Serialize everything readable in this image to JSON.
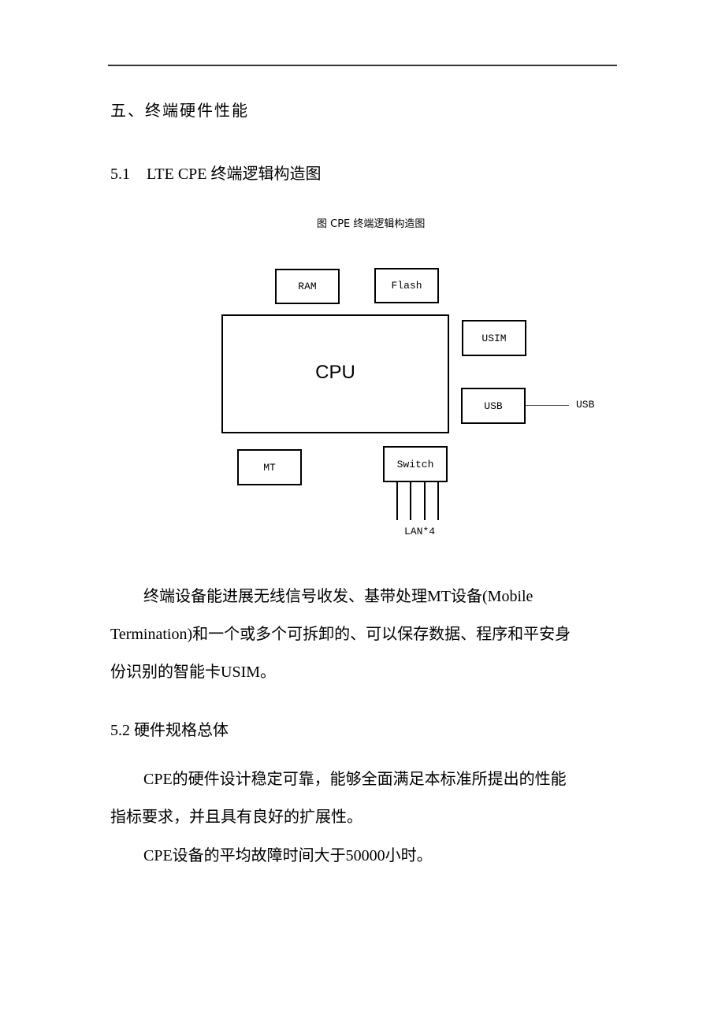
{
  "section": {
    "heading": "五、终端硬件性能",
    "sub1_num": "5.1",
    "sub1_title": "LTE CPE 终端逻辑构造图",
    "figure_caption": "图  CPE 终端逻辑构造图",
    "diagram": {
      "cpu": "CPU",
      "ram": "RAM",
      "flash": "Flash",
      "usim": "USIM",
      "usb_box": "USB",
      "usb_port": "USB",
      "mt": "MT",
      "switch": "Switch",
      "lan": "LAN*4"
    },
    "para1_line1": "终端设备能进展无线信号收发、基带处理MT设备(Mobile",
    "para1_line2": "Termination)和一个或多个可拆卸的、可以保存数据、程序和平安身",
    "para1_line3": "份识别的智能卡USIM。",
    "sub2_title": "5.2 硬件规格总体",
    "para2_line1": "CPE的硬件设计稳定可靠，能够全面满足本标准所提出的性能",
    "para2_line2": "指标要求，并且具有良好的扩展性。",
    "para3": "CPE设备的平均故障时间大于50000小时。"
  }
}
